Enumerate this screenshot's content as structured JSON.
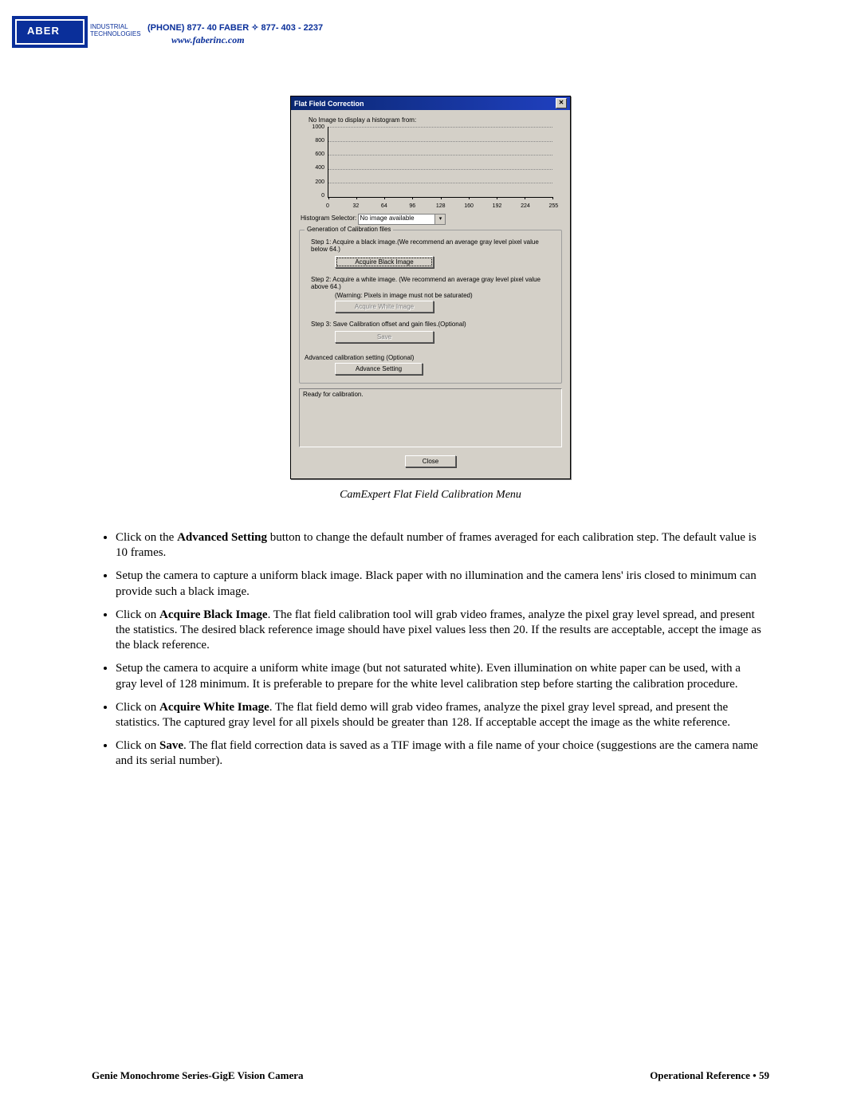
{
  "header": {
    "logo_text": "ABER",
    "logo_sub": "INDUSTRIAL\nTECHNOLOGIES",
    "phone": "(PHONE) 877- 40 FABER  ✧  877- 403 - 2237",
    "url": "www.faberinc.com"
  },
  "dialog": {
    "title": "Flat Field Correction",
    "no_histo": "No Image to display a histogram from:",
    "y_ticks": [
      "1000",
      "800",
      "600",
      "400",
      "200",
      "0"
    ],
    "x_ticks": [
      "0",
      "32",
      "64",
      "96",
      "128",
      "160",
      "192",
      "224",
      "255"
    ],
    "histogram_selector_label": "Histogram Selector:",
    "histogram_selector_value": "No image available",
    "group_legend": "Generation of Calibration files",
    "step1": "Step 1:  Acquire a black image.(We recommend an average gray level pixel value below 64.)",
    "btn_black": "Acquire Black Image",
    "step2": "Step 2:  Acquire a white image. (We recommend an average gray level pixel value above 64.)",
    "step2_warn": "(Warning: Pixels in image must not be saturated)",
    "btn_white": "Acquire White Image",
    "step3": "Step 3:  Save Calibration offset and gain files.(Optional)",
    "btn_save": "Save",
    "advanced_label": "Advanced calibration setting (Optional)",
    "btn_advanced": "Advance Setting",
    "status_text": "Ready for calibration.",
    "btn_close": "Close"
  },
  "caption": "CamExpert Flat Field Calibration Menu",
  "bullets": [
    {
      "pre": "Click on the ",
      "bold": "Advanced Setting",
      "post": " button to change the default number of frames averaged for each calibration step. The default value is 10 frames."
    },
    {
      "pre": "Setup the camera to capture a uniform black image. Black paper with no illumination and the camera lens' iris closed to minimum can provide such a black image.",
      "bold": "",
      "post": ""
    },
    {
      "pre": "Click on ",
      "bold": "Acquire Black Image",
      "post": ". The flat field calibration tool will grab video frames, analyze the pixel gray level spread, and present the statistics. The desired black reference image should have pixel values less then 20. If the results are acceptable, accept the image as the black reference."
    },
    {
      "pre": "Setup the camera to acquire a uniform white image (but not saturated white). Even illumination on white paper can be used, with a gray level of 128 minimum. It is preferable to prepare for the white level calibration step before starting the calibration procedure.",
      "bold": "",
      "post": ""
    },
    {
      "pre": "Click on ",
      "bold": "Acquire White Image",
      "post": ". The flat field demo will grab video frames, analyze the pixel gray level spread, and present the statistics. The captured gray level for all pixels should be greater than 128. If acceptable accept the image as the white reference."
    },
    {
      "pre": "Click on ",
      "bold": "Save",
      "post": ". The flat field correction data is saved as a TIF image with a file name of your choice (suggestions are the camera name and its serial number)."
    }
  ],
  "footer": {
    "left": "Genie Monochrome Series-GigE Vision Camera",
    "right": "Operational Reference  •  59"
  }
}
